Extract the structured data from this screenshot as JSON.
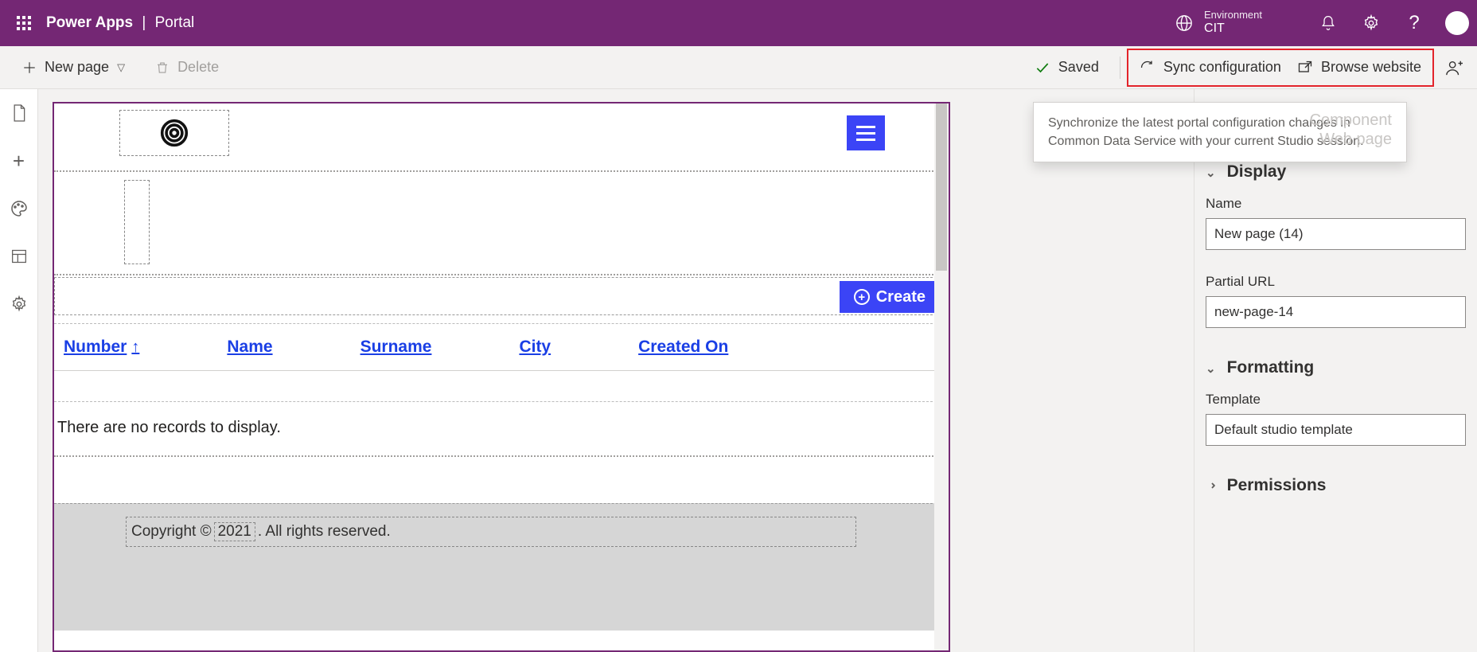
{
  "header": {
    "app": "Power Apps",
    "separator": "|",
    "area": "Portal",
    "env_label": "Environment",
    "env_value": "CIT"
  },
  "commandbar": {
    "new_page": "New page",
    "delete": "Delete",
    "saved": "Saved",
    "sync": "Sync configuration",
    "browse": "Browse website"
  },
  "tooltip": {
    "text": "Synchronize the latest portal configuration changes in Common Data Service with your current Studio session.",
    "ghost_line1": "Component",
    "ghost_line2": "Web page"
  },
  "canvas": {
    "create_label": "Create",
    "columns": {
      "number": "Number",
      "name": "Name",
      "surname": "Surname",
      "city": "City",
      "created": "Created On"
    },
    "empty": "There are no records to display.",
    "footer_prefix": "Copyright © ",
    "footer_year": "2021",
    "footer_suffix": ". All rights reserved."
  },
  "properties": {
    "section_display": "Display",
    "name_label": "Name",
    "name_value": "New page (14)",
    "url_label": "Partial URL",
    "url_value": "new-page-14",
    "section_formatting": "Formatting",
    "template_label": "Template",
    "template_value": "Default studio template",
    "section_permissions": "Permissions"
  }
}
